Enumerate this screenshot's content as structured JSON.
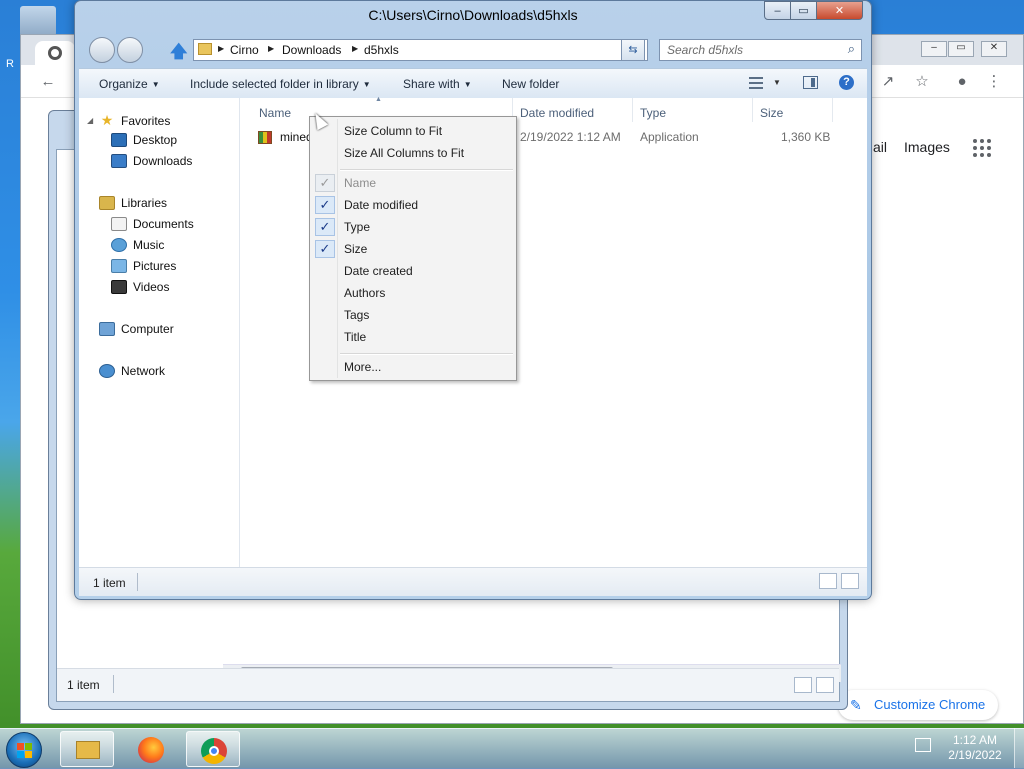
{
  "explorer": {
    "title": "C:\\Users\\Cirno\\Downloads\\d5hxls",
    "controls": {
      "minimize": "–",
      "maximize": "▭",
      "close": "✕"
    },
    "address": {
      "crumbs": [
        "Cirno",
        "Downloads",
        "d5hxls"
      ]
    },
    "search_placeholder": "Search d5hxls",
    "commands": {
      "organize": "Organize",
      "include": "Include selected folder in library",
      "share": "Share with",
      "new_folder": "New folder"
    },
    "nav": {
      "favorites": "Favorites",
      "desktop": "Desktop",
      "downloads": "Downloads",
      "libraries": "Libraries",
      "documents": "Documents",
      "music": "Music",
      "pictures": "Pictures",
      "videos": "Videos",
      "computer": "Computer",
      "network": "Network"
    },
    "columns": {
      "name": "Name",
      "date": "Date modified",
      "type": "Type",
      "size": "Size"
    },
    "files": [
      {
        "name": "mined",
        "date": "2/19/2022 1:12 AM",
        "type": "Application",
        "size": "1,360 KB"
      }
    ],
    "status": "1 item"
  },
  "context_menu": {
    "size_column": "Size Column to Fit",
    "size_all": "Size All Columns to Fit",
    "items": [
      {
        "label": "Name",
        "checked": true,
        "disabled": true
      },
      {
        "label": "Date modified",
        "checked": true
      },
      {
        "label": "Type",
        "checked": true
      },
      {
        "label": "Size",
        "checked": true
      },
      {
        "label": "Date created",
        "checked": false
      },
      {
        "label": "Authors",
        "checked": false
      },
      {
        "label": "Tags",
        "checked": false
      },
      {
        "label": "Title",
        "checked": false
      }
    ],
    "more": "More..."
  },
  "background_explorer": {
    "status": "1 item"
  },
  "chrome": {
    "links": {
      "gmail": "ail",
      "images": "Images"
    },
    "customize": "Customize Chrome"
  },
  "taskbar": {
    "time": "1:12 AM",
    "date": "2/19/2022"
  }
}
